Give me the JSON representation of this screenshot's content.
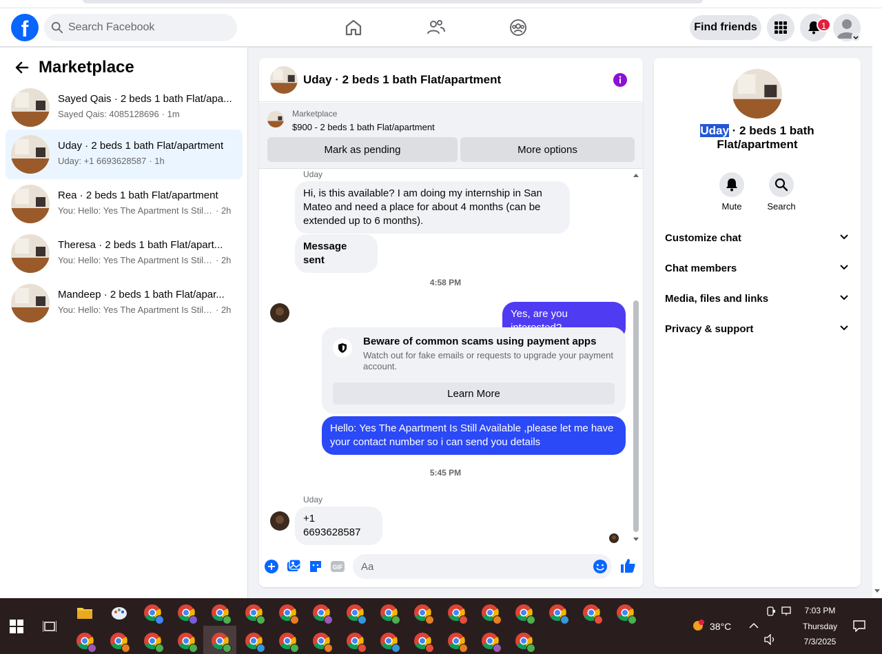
{
  "topbar": {
    "logo": "f",
    "search_placeholder": "Search Facebook",
    "find_friends": "Find friends",
    "notification_count": "1"
  },
  "left": {
    "title": "Marketplace",
    "threads": [
      {
        "title": "Sayed Qais · 2 beds 1 bath Flat/apa...",
        "preview": "Sayed Qais: 4085128696",
        "time": "· 1m"
      },
      {
        "title": "Uday · 2 beds 1 bath Flat/apartment",
        "preview": "Uday: +1 6693628587",
        "time": "· 1h"
      },
      {
        "title": "Rea · 2 beds 1 bath Flat/apartment",
        "preview": "You: Hello: Yes The Apartment Is Still ...",
        "time": "· 2h"
      },
      {
        "title": "Theresa · 2 beds 1 bath Flat/apart...",
        "preview": "You: Hello: Yes The Apartment Is Still ...",
        "time": "· 2h"
      },
      {
        "title": "Mandeep · 2 beds 1 bath Flat/apar...",
        "preview": "You: Hello: Yes The Apartment Is Still ...",
        "time": "· 2h"
      }
    ]
  },
  "chat": {
    "title": "Uday · 2 beds 1 bath Flat/apartment",
    "marketplace_label": "Marketplace",
    "listing": "$900 - 2 beds 1 bath Flat/apartment",
    "mark_pending": "Mark as pending",
    "more_options": "More options",
    "sender1": "Uday",
    "msg1": "Hi, is this available? I am doing my internship in San Mateo and need a place for about 4 months (can be extended up to 6 months).",
    "msg2": "Message sent",
    "time1": "4:58 PM",
    "msg3": "Yes, are you interested?",
    "scam_title": "Beware of common scams using payment apps",
    "scam_desc": "Watch out for fake emails or requests to upgrade your payment account.",
    "learn_more": "Learn More",
    "msg4": "Hello: Yes The Apartment Is Still Available ,please let me have your contact number so i can send you details",
    "time2": "5:45 PM",
    "sender2": "Uday",
    "msg5": "+1 6693628587",
    "composer_placeholder": "Aa",
    "gif_label": "GIF"
  },
  "right": {
    "name_highlight": "Uday",
    "name_rest": " · 2 beds 1 bath Flat/apartment",
    "mute": "Mute",
    "search": "Search",
    "sections": [
      "Customize chat",
      "Chat members",
      "Media, files and links",
      "Privacy & support"
    ]
  },
  "taskbar": {
    "temp": "38°C",
    "time": "7:03 PM",
    "day": "Thursday",
    "date": "7/3/2025"
  },
  "colors": {
    "brand": "#0866ff",
    "outgoing_bubble": "#4f3bf2",
    "outgoing_bubble_2": "#2b49f7",
    "active_thread": "#ebf5ff",
    "info_icon": "#8a12d6"
  }
}
